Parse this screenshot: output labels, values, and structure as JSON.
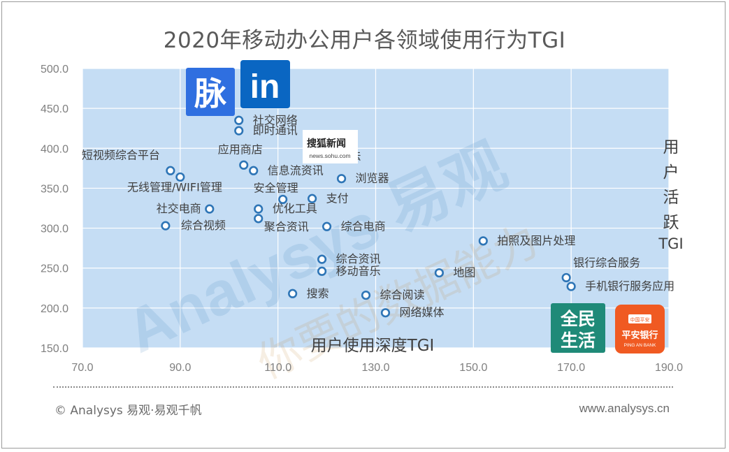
{
  "title": "2020年移动办公用户各领域使用行为TGI",
  "chart_data": {
    "type": "scatter",
    "xlabel": "用户使用深度TGI",
    "ylabel": "用户活跃TGI",
    "xlim": [
      70,
      190
    ],
    "ylim": [
      150,
      500
    ],
    "xticks": [
      "70.0",
      "90.0",
      "110.0",
      "130.0",
      "150.0",
      "170.0",
      "190.0"
    ],
    "yticks": [
      "500.0",
      "450.0",
      "400.0",
      "350.0",
      "300.0",
      "250.0",
      "200.0",
      "150.0"
    ],
    "grid": true,
    "points": [
      {
        "label": "社交网络",
        "x": 102,
        "y": 435
      },
      {
        "label": "即时通讯",
        "x": 102,
        "y": 422
      },
      {
        "label": "中文输入法",
        "x": 117,
        "y": 390
      },
      {
        "label": "短视频综合平台",
        "x": 88,
        "y": 372
      },
      {
        "label": "应用商店",
        "x": 103,
        "y": 379
      },
      {
        "label": "信息流资讯",
        "x": 105,
        "y": 372
      },
      {
        "label": "无线管理/WIFI管理",
        "x": 90,
        "y": 364
      },
      {
        "label": "浏览器",
        "x": 123,
        "y": 362
      },
      {
        "label": "安全管理",
        "x": 111,
        "y": 336
      },
      {
        "label": "支付",
        "x": 117,
        "y": 337
      },
      {
        "label": "社交电商",
        "x": 96,
        "y": 324
      },
      {
        "label": "优化工具",
        "x": 106,
        "y": 324
      },
      {
        "label": "聚合资讯",
        "x": 106,
        "y": 312
      },
      {
        "label": "综合视频",
        "x": 87,
        "y": 303
      },
      {
        "label": "综合电商",
        "x": 120,
        "y": 302
      },
      {
        "label": "拍照及图片处理",
        "x": 152,
        "y": 284
      },
      {
        "label": "综合资讯",
        "x": 119,
        "y": 261
      },
      {
        "label": "移动音乐",
        "x": 119,
        "y": 246
      },
      {
        "label": "地图",
        "x": 143,
        "y": 244
      },
      {
        "label": "银行综合服务",
        "x": 169,
        "y": 238
      },
      {
        "label": "手机银行服务应用",
        "x": 170,
        "y": 227
      },
      {
        "label": "搜索",
        "x": 113,
        "y": 218
      },
      {
        "label": "综合阅读",
        "x": 128,
        "y": 216
      },
      {
        "label": "网络媒体",
        "x": 132,
        "y": 194
      }
    ]
  },
  "logos": {
    "maimai": "脉",
    "linkedin": "in",
    "sohu_top": "搜狐新闻",
    "sohu_bottom": "news.sohu.com",
    "quanmin_top": "全民",
    "quanmin_bottom": "生活",
    "pingan_top": "平安银行",
    "pingan_bottom": "PING AN BANK",
    "pingan_badge": "中国平安"
  },
  "watermark": "Analysys 易观",
  "watermark_sub": "你要的数据能力",
  "footer": {
    "left": "© Analysys 易观·易观千帆",
    "right": "www.analysys.cn"
  },
  "colors": {
    "plot_bg": "#c5ddf4",
    "marker": "#2e75b6",
    "grid": "#ffffff",
    "maimai": "#2f6fe0",
    "linkedin": "#0a66c2",
    "quanmin": "#1f8a78",
    "pingan": "#f05a22"
  }
}
